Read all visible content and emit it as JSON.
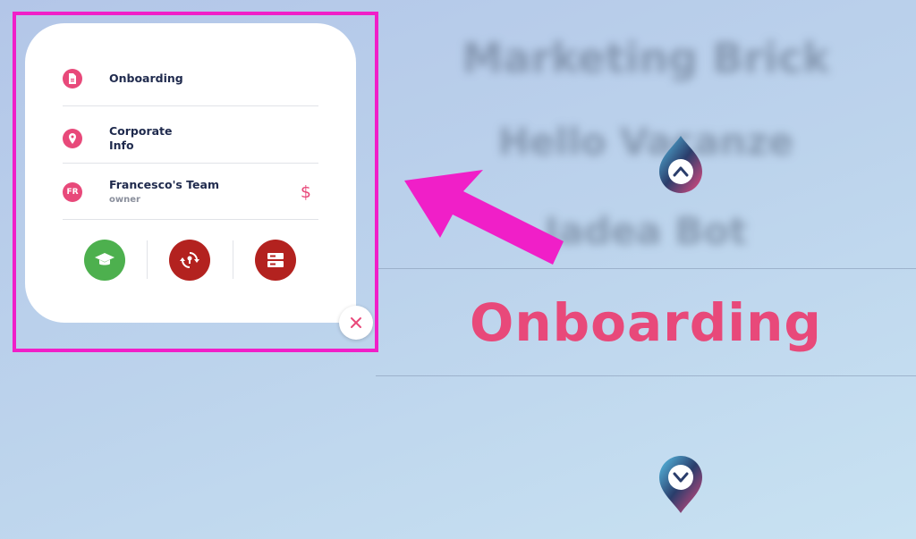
{
  "picker": {
    "blurred_items": [
      "Marketing Brick",
      "Hello Vacanze",
      "Jadea Bot"
    ],
    "selected": "Onboarding"
  },
  "menu": {
    "items": [
      {
        "label": "Onboarding",
        "icon": "document-icon"
      },
      {
        "label": "Corporate Info",
        "icon": "location-pin-icon"
      },
      {
        "label": "Francesco's Team",
        "sublabel": "owner",
        "avatar": "FR",
        "icon": "dollar-icon"
      }
    ],
    "actions": [
      {
        "icon": "graduation-cap-icon",
        "color": "#4db04e"
      },
      {
        "icon": "sync-icon",
        "color": "#b3221f"
      },
      {
        "icon": "server-icon",
        "color": "#b3221f"
      }
    ],
    "close_icon": "close-icon"
  },
  "colors": {
    "accent": "#e8497a",
    "highlight": "#f01fc8",
    "arc": "#5cc5ea",
    "text_dark": "#1f2a4d"
  }
}
